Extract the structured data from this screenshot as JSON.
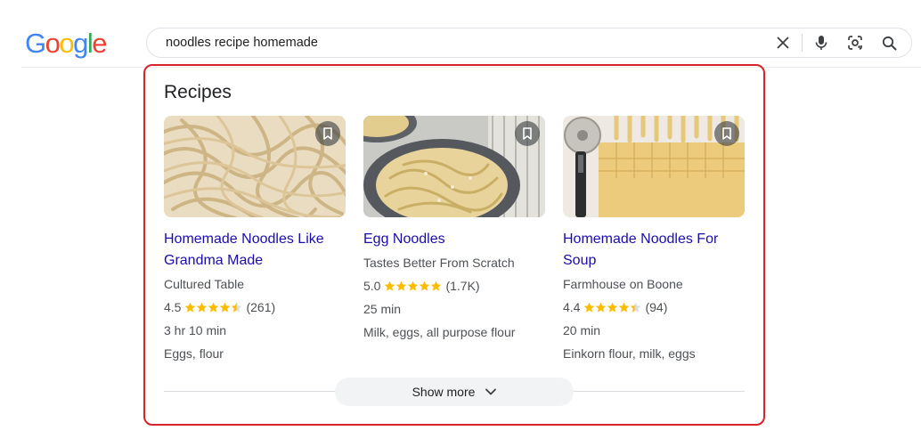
{
  "logo": {
    "letters": [
      "G",
      "o",
      "o",
      "g",
      "l",
      "e"
    ]
  },
  "search": {
    "query": "noodles recipe homemade"
  },
  "section": {
    "title": "Recipes"
  },
  "recipes": [
    {
      "title_line1": "Homemade Noodles Like",
      "title_line2": "Grandma Made",
      "source": "Cultured Table",
      "rating": "4.5",
      "rating_value": 4.5,
      "reviews": "(261)",
      "time": "3 hr 10 min",
      "ingredients": "Eggs, flour"
    },
    {
      "title_line1": "Egg Noodles",
      "title_line2": "",
      "source": "Tastes Better From Scratch",
      "rating": "5.0",
      "rating_value": 5.0,
      "reviews": "(1.7K)",
      "time": "25 min",
      "ingredients": "Milk, eggs, all purpose flour"
    },
    {
      "title_line1": "Homemade Noodles For",
      "title_line2": "Soup",
      "source": "Farmhouse on Boone",
      "rating": "4.4",
      "rating_value": 4.4,
      "reviews": "(94)",
      "time": "20 min",
      "ingredients": "Einkorn flour, milk, eggs"
    }
  ],
  "show_more": {
    "label": "Show more"
  },
  "colors": {
    "link": "#1a0dab",
    "star": "#fbbc04",
    "highlight_border": "#d9222a"
  }
}
